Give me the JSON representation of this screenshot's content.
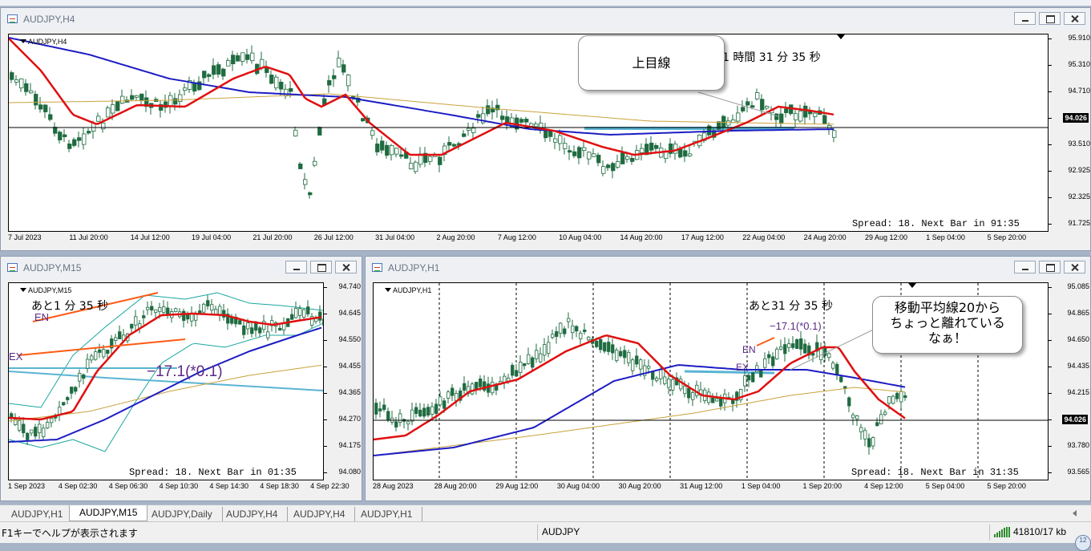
{
  "colors": {
    "candle": "#1f6b40",
    "ma_red": "#e01010",
    "ma_blue": "#1c1cc4",
    "ma_tan": "#c9a23a",
    "hline_cyan": "#5ab4d4",
    "hline_orange": "#ff5a14",
    "bollinger": "#1aa7a0",
    "annot_purple": "#5b2a86"
  },
  "icons": {
    "chart": "chart-window-icon",
    "minimize": "minimize-icon",
    "maximize": "maximize-icon",
    "close": "close-icon"
  },
  "windows": [
    {
      "id": "h4",
      "title": "AUDJPY,H4",
      "symbol_label": "AUDJPY,H4",
      "y_labels": [
        "95.910",
        "95.310",
        "94.710",
        "94.026",
        "93.510",
        "92.925",
        "92.325",
        "91.725"
      ],
      "current_price": "94.026",
      "x_labels": [
        "7 Jul 2023",
        "11 Jul 20:00",
        "14 Jul 12:00",
        "19 Jul 04:00",
        "21 Jul 20:00",
        "26 Jul 12:00",
        "31 Jul 04:00",
        "2 Aug 20:00",
        "7 Aug 12:00",
        "10 Aug 04:00",
        "14 Aug 20:00",
        "17 Aug 12:00",
        "22 Aug 04:00",
        "24 Aug 20:00",
        "29 Aug 12:00",
        "1 Sep 04:00",
        "5 Sep 20:00"
      ],
      "timer": "1 時間 31 分 35 秒",
      "spread_text": "Spread: 18. Next Bar in 91:35",
      "callout": [
        "上目線"
      ]
    },
    {
      "id": "m15",
      "title": "AUDJPY,M15",
      "symbol_label": "AUDJPY,M15",
      "y_labels": [
        "94.740",
        "94.645",
        "94.550",
        "94.455",
        "94.365",
        "94.270",
        "94.175",
        "94.080"
      ],
      "x_labels": [
        "1 Sep 2023",
        "4 Sep 02:30",
        "4 Sep 06:30",
        "4 Sep 10:30",
        "4 Sep 14:30",
        "4 Sep 18:30",
        "4 Sep 22:30"
      ],
      "timer": "あと1 分 35 秒",
      "en_label": "EN",
      "ex_label": "EX",
      "pnl": "−17.1(*0.1)",
      "spread_text": "Spread: 18. Next Bar in 01:35"
    },
    {
      "id": "h1",
      "title": "AUDJPY,H1",
      "symbol_label": "AUDJPY,H1",
      "y_labels": [
        "95.085",
        "94.865",
        "94.650",
        "94.435",
        "94.215",
        "94.026",
        "93.780",
        "93.565"
      ],
      "current_price": "94.026",
      "x_labels": [
        "28 Aug 2023",
        "28 Aug 20:00",
        "29 Aug 12:00",
        "30 Aug 04:00",
        "30 Aug 20:00",
        "31 Aug 12:00",
        "1 Sep 04:00",
        "1 Sep 20:00",
        "4 Sep 12:00",
        "5 Sep 04:00",
        "5 Sep 20:00"
      ],
      "timer": "あと31 分 35 秒",
      "en_label": "EN",
      "ex_label": "EX",
      "pnl": "−17.1(*0.1)",
      "spread_text": "Spread: 18. Next Bar in 31:35",
      "callout": [
        "移動平均線20から",
        "ちょっと離れている",
        "なぁ！"
      ]
    }
  ],
  "tabs": [
    "AUDJPY,H1",
    "AUDJPY,M15",
    "AUDJPY,Daily",
    "AUDJPY,H4",
    "AUDJPY,H4",
    "AUDJPY,H1"
  ],
  "active_tab_index": 1,
  "status": {
    "help": "F1キーでヘルプが表示されます",
    "symbol": "AUDJPY",
    "traffic": "41810/17 kb",
    "corner": "12"
  }
}
